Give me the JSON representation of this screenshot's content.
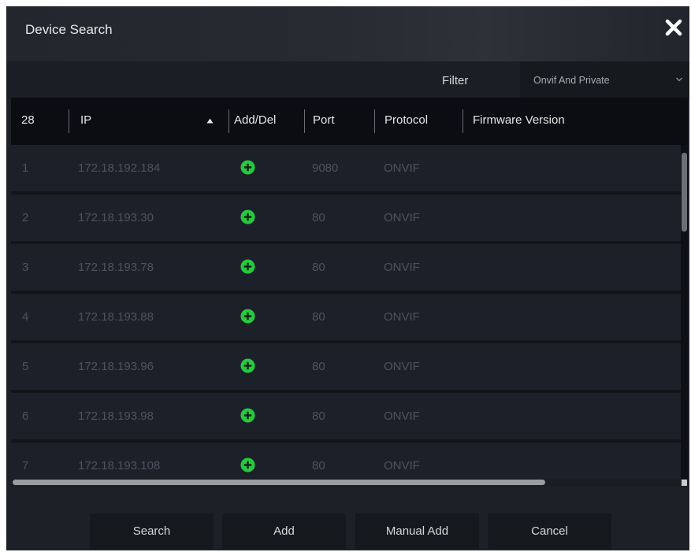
{
  "dialog": {
    "title": "Device Search"
  },
  "filter": {
    "label": "Filter",
    "value": "Onvif And Private"
  },
  "table": {
    "count": "28",
    "headers": {
      "ip": "IP",
      "add_del": "Add/Del",
      "port": "Port",
      "protocol": "Protocol",
      "firmware": "Firmware Version"
    },
    "rows": [
      {
        "no": "1",
        "ip": "172.18.192.184",
        "port": "9080",
        "protocol": "ONVIF"
      },
      {
        "no": "2",
        "ip": "172.18.193.30",
        "port": "80",
        "protocol": "ONVIF"
      },
      {
        "no": "3",
        "ip": "172.18.193.78",
        "port": "80",
        "protocol": "ONVIF"
      },
      {
        "no": "4",
        "ip": "172.18.193.88",
        "port": "80",
        "protocol": "ONVIF"
      },
      {
        "no": "5",
        "ip": "172.18.193.96",
        "port": "80",
        "protocol": "ONVIF"
      },
      {
        "no": "6",
        "ip": "172.18.193.98",
        "port": "80",
        "protocol": "ONVIF"
      },
      {
        "no": "7",
        "ip": "172.18.193.108",
        "port": "80",
        "protocol": "ONVIF"
      }
    ]
  },
  "buttons": {
    "search": "Search",
    "add": "Add",
    "manual_add": "Manual Add",
    "cancel": "Cancel"
  },
  "icons": {
    "close": "close-icon",
    "dropdown": "chevron-down-icon",
    "sort": "sort-ascending-icon",
    "add_device": "plus-circle-icon"
  },
  "colors": {
    "add_icon": "#27c93f",
    "dialog_bg": "#1d2026",
    "row_bg": "#1c2129"
  }
}
